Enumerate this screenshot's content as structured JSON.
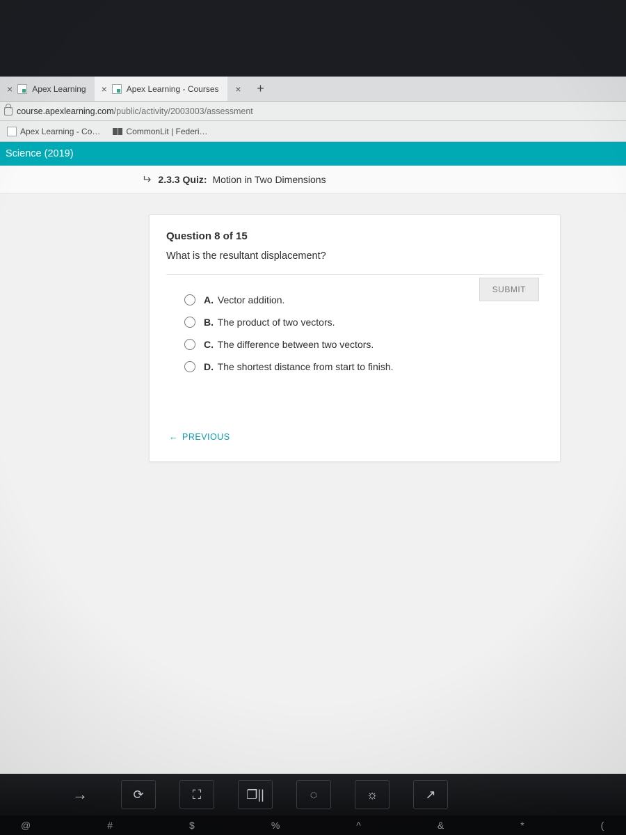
{
  "tabs": {
    "t1": "Apex Learning",
    "t2": "Apex Learning - Courses"
  },
  "url": {
    "domain": "course.apexlearning.com",
    "path": "/public/activity/2003003/assessment"
  },
  "bookmarks": {
    "b1": "Apex Learning - Co…",
    "b2": "CommonLit | Federi…"
  },
  "course_header": "Science (2019)",
  "quiz": {
    "code": "2.3.3",
    "label": "Quiz:",
    "title": "Motion in Two Dimensions"
  },
  "question": {
    "counter": "Question 8 of 15",
    "prompt": "What is the resultant displacement?",
    "options": {
      "a": {
        "letter": "A.",
        "text": "Vector addition."
      },
      "b": {
        "letter": "B.",
        "text": "The product of two vectors."
      },
      "c": {
        "letter": "C.",
        "text": "The difference between two vectors."
      },
      "d": {
        "letter": "D.",
        "text": "The shortest distance from start to finish."
      }
    },
    "submit": "SUBMIT",
    "previous": "PREVIOUS"
  },
  "keys": {
    "at": "@",
    "hash": "#",
    "dollar": "$",
    "pct": "%",
    "caret": "^",
    "amp": "&",
    "star": "*",
    "paren": "("
  }
}
